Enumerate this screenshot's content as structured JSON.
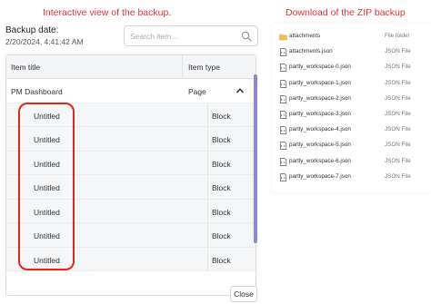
{
  "captions": {
    "left": "Interactive view of the backup.",
    "right": "Download of the ZIP backup"
  },
  "backup": {
    "label": "Backup date:",
    "date": "2/20/2024, 4:41:42 AM"
  },
  "search": {
    "placeholder": "Search item...",
    "icon": "search-icon"
  },
  "table": {
    "headers": {
      "title": "Item title",
      "type": "Item type"
    },
    "parent": {
      "title": "PM Dashboard",
      "type": "Page",
      "icon": "chevron-up-icon"
    },
    "children": [
      {
        "title": "Untitled",
        "type": "Block"
      },
      {
        "title": "Untitled",
        "type": "Block"
      },
      {
        "title": "Untitled",
        "type": "Block"
      },
      {
        "title": "Untitled",
        "type": "Block"
      },
      {
        "title": "Untitled",
        "type": "Block"
      },
      {
        "title": "Untitled",
        "type": "Block"
      },
      {
        "title": "Untitled",
        "type": "Block"
      }
    ]
  },
  "close_label": "Close",
  "files": [
    {
      "name": "attachments",
      "type": "File folder",
      "icon": "folder-icon"
    },
    {
      "name": "attachments.json",
      "type": "JSON File",
      "icon": "json-file-icon"
    },
    {
      "name": "partly_workspace-0.json",
      "type": "JSON File",
      "icon": "json-file-icon"
    },
    {
      "name": "partly_workspace-1.json",
      "type": "JSON File",
      "icon": "json-file-icon"
    },
    {
      "name": "partly_workspace-2.json",
      "type": "JSON File",
      "icon": "json-file-icon"
    },
    {
      "name": "partly_workspace-3.json",
      "type": "JSON File",
      "icon": "json-file-icon"
    },
    {
      "name": "partly_workspace-4.json",
      "type": "JSON File",
      "icon": "json-file-icon"
    },
    {
      "name": "partly_workspace-5.json",
      "type": "JSON File",
      "icon": "json-file-icon"
    },
    {
      "name": "partly_workspace-6.json",
      "type": "JSON File",
      "icon": "json-file-icon"
    },
    {
      "name": "partly_workspace-7.json",
      "type": "JSON File",
      "icon": "json-file-icon"
    }
  ],
  "colors": {
    "annotation": "#e1261c",
    "scrollbar": "#8f86e0",
    "folder": "#f2c14e"
  }
}
